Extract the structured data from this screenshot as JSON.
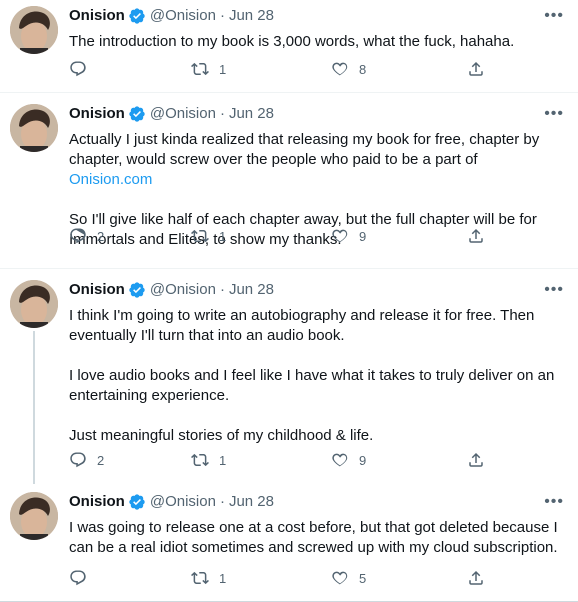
{
  "tweets": [
    {
      "name": "Onision",
      "handle": "@Onision",
      "separator": "·",
      "date": "Jun 28",
      "text": "The introduction to my book is 3,000 words, what the fuck, hahaha.",
      "reply_count": "",
      "retweet_count": "1",
      "like_count": "8"
    },
    {
      "name": "Onision",
      "handle": "@Onision",
      "separator": "·",
      "date": "Jun 28",
      "text": "Actually I just kinda realized that releasing my book for free, chapter by chapter, would screw over the people who paid to be a part of ",
      "link": "Onision.com",
      "text_after": "\n\nSo I'll give like half of each chapter away, but the full chapter will be for Immortals and Elites, to show my thanks.",
      "reply_count": "2",
      "retweet_count": "1",
      "like_count": "9"
    },
    {
      "name": "Onision",
      "handle": "@Onision",
      "separator": "·",
      "date": "Jun 28",
      "text": "I think I'm going to write an autobiography and release it for free. Then eventually I'll turn that into an audio book.\n\nI love audio books and I feel like I have what it takes to truly deliver on an entertaining experience.\n\nJust meaningful stories of my childhood & life.",
      "reply_count": "2",
      "retweet_count": "1",
      "like_count": "9"
    },
    {
      "name": "Onision",
      "handle": "@Onision",
      "separator": "·",
      "date": "Jun 28",
      "text": "I was going to release one at a cost before, but that got deleted because I can be a real idiot sometimes and screwed up with my cloud subscription.",
      "reply_count": "",
      "retweet_count": "1",
      "like_count": "5"
    }
  ],
  "icons": {
    "more": "more-icon",
    "verified": "verified-badge-icon",
    "reply": "reply-icon",
    "retweet": "retweet-icon",
    "like": "like-icon",
    "share": "share-icon"
  },
  "colors": {
    "accent": "#1d9bf0",
    "muted": "#536471",
    "text": "#0f1419",
    "thread_line": "#cfd9de"
  }
}
